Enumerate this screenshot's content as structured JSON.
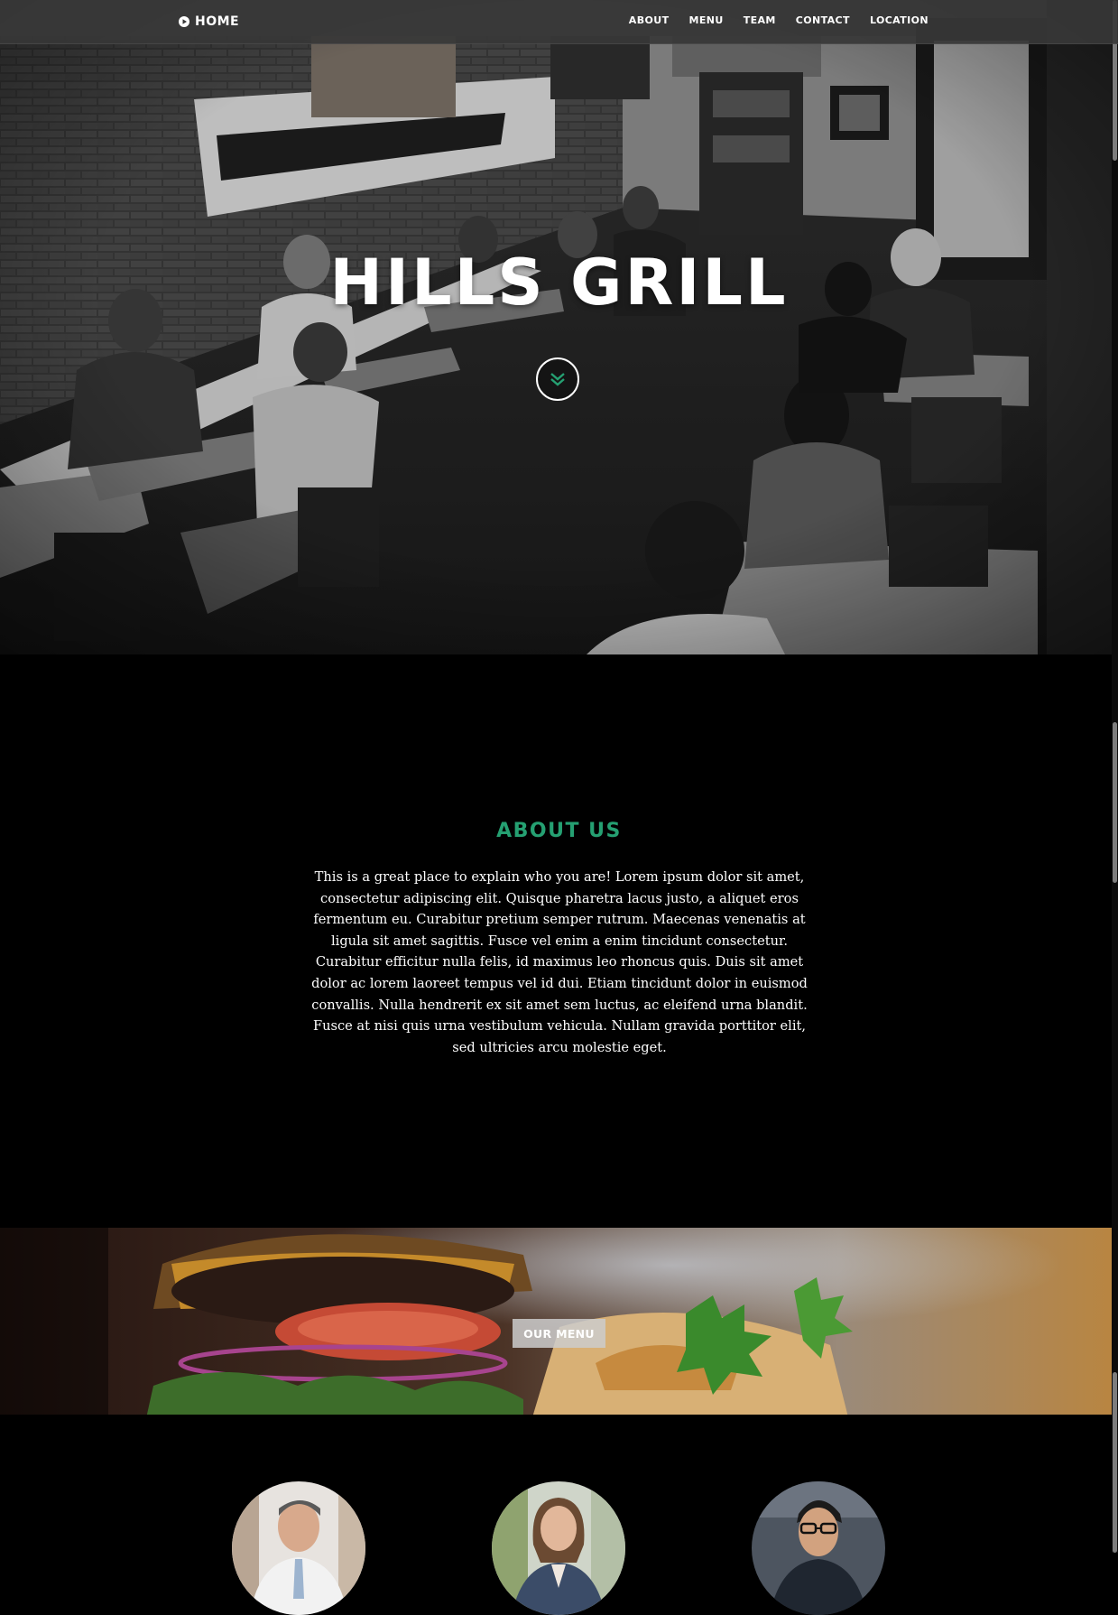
{
  "nav": {
    "brand_label": "HOME",
    "links": [
      {
        "label": "ABOUT"
      },
      {
        "label": "MENU"
      },
      {
        "label": "TEAM"
      },
      {
        "label": "CONTACT"
      },
      {
        "label": "LOCATION"
      }
    ]
  },
  "hero": {
    "title": "HILLS GRILL",
    "scroll_icon": "double-chevron-down-icon"
  },
  "about": {
    "title": "ABOUT US",
    "body": "This is a great place to explain who you are! Lorem ipsum dolor sit amet, consectetur adipiscing elit. Quisque pharetra lacus justo, a aliquet eros fermentum eu. Curabitur pretium semper rutrum. Maecenas venenatis at ligula sit amet sagittis. Fusce vel enim a enim tincidunt consectetur. Curabitur efficitur nulla felis, id maximus leo rhoncus quis. Duis sit amet dolor ac lorem laoreet tempus vel id dui. Etiam tincidunt dolor in euismod convallis. Nulla hendrerit ex sit amet sem luctus, ac eleifend urna blandit. Fusce at nisi quis urna vestibulum vehicula. Nullam gravida porttitor elit, sed ultricies arcu molestie eget."
  },
  "menu_banner": {
    "button_label": "OUR MENU"
  },
  "team": {
    "members": [
      {
        "avatar": "team-member-1"
      },
      {
        "avatar": "team-member-2"
      },
      {
        "avatar": "team-member-3"
      }
    ]
  },
  "colors": {
    "accent": "#25a072",
    "nav_bg": "#373737",
    "page_bg": "#000000"
  }
}
